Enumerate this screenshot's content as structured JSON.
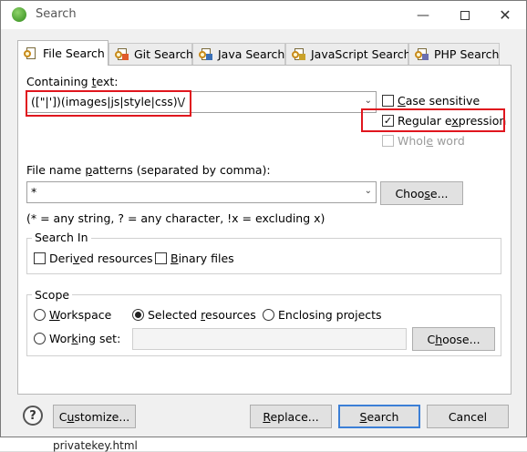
{
  "window": {
    "title": "Search"
  },
  "tabs": [
    {
      "label": "File Search",
      "active": true,
      "icon": "file-search-icon"
    },
    {
      "label": "Git Search",
      "active": false,
      "icon": "git-search-icon"
    },
    {
      "label": "Java Search",
      "active": false,
      "icon": "java-search-icon"
    },
    {
      "label": "JavaScript Search",
      "active": false,
      "icon": "javascript-search-icon"
    },
    {
      "label": "PHP Search",
      "active": false,
      "icon": "php-search-icon"
    }
  ],
  "containing_text": {
    "label": "Containing text:",
    "value": "([\"|'])(images|js|style|css)\\/",
    "options": {
      "case_sensitive": {
        "label": "Case sensitive",
        "checked": false
      },
      "regular_expression": {
        "label": "Regular expression",
        "checked": true
      },
      "whole_word": {
        "label": "Whole word",
        "checked": false,
        "disabled": true
      }
    }
  },
  "file_patterns": {
    "label": "File name patterns (separated by comma):",
    "value": "*",
    "choose_label": "Choose...",
    "hint": "(* = any string, ? = any character, !x = excluding x)"
  },
  "search_in": {
    "title": "Search In",
    "derived_label": "Derived resources",
    "derived_checked": false,
    "binary_label": "Binary files",
    "binary_checked": false
  },
  "scope": {
    "title": "Scope",
    "workspace_label": "Workspace",
    "selected_label": "Selected resources",
    "enclosing_label": "Enclosing projects",
    "working_set_label": "Working set:",
    "working_set_value": "",
    "choose_label": "Choose...",
    "selected": "Selected resources"
  },
  "buttons": {
    "help": "?",
    "customize": "Customize...",
    "replace": "Replace...",
    "search": "Search",
    "cancel": "Cancel"
  },
  "background": {
    "file_name": "privatekey.html"
  },
  "colors": {
    "annotation": "#e0161e",
    "default_button_border": "#3c7fd6"
  }
}
